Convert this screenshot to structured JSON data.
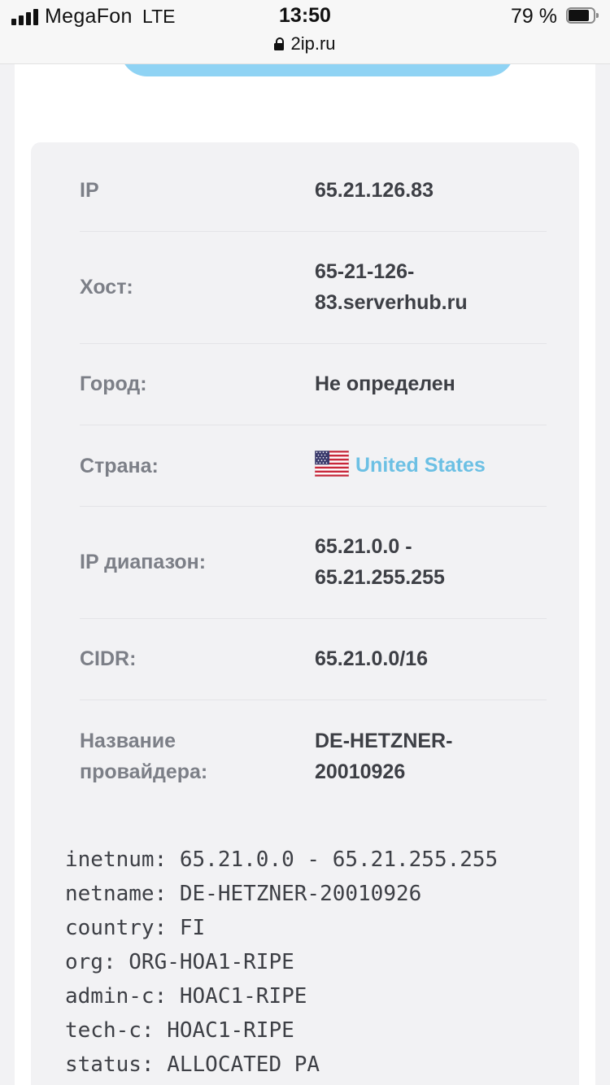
{
  "status_bar": {
    "carrier": "MegaFon",
    "network": "LTE",
    "time": "13:50",
    "battery": "79 %",
    "url": "2ip.ru"
  },
  "colors": {
    "accent": "#8fd3f4",
    "link": "#6cc0e4",
    "label": "#7c7f87",
    "value": "#3d3f45"
  },
  "info": {
    "ip": {
      "label": "IP",
      "value": "65.21.126.83"
    },
    "host": {
      "label": "Хост:",
      "value_line1": "65-21-126-",
      "value_line2": "83.serverhub.ru"
    },
    "city": {
      "label": "Город:",
      "value": "Не определен"
    },
    "country": {
      "label": "Страна:",
      "value": "United States",
      "flag": "us-flag-icon"
    },
    "ip_range": {
      "label": "IP диапазон:",
      "value_line1": "65.21.0.0 -",
      "value_line2": "65.21.255.255"
    },
    "cidr": {
      "label": "CIDR:",
      "value": "65.21.0.0/16"
    },
    "provider": {
      "label_line1": "Название",
      "label_line2": "провайдера:",
      "value_line1": "DE-HETZNER-",
      "value_line2": "20010926"
    }
  },
  "whois": [
    "inetnum: 65.21.0.0 - 65.21.255.255",
    "netname: DE-HETZNER-20010926",
    "country: FI",
    "org: ORG-HOA1-RIPE",
    "admin-c: HOAC1-RIPE",
    "tech-c: HOAC1-RIPE",
    "status: ALLOCATED PA"
  ]
}
